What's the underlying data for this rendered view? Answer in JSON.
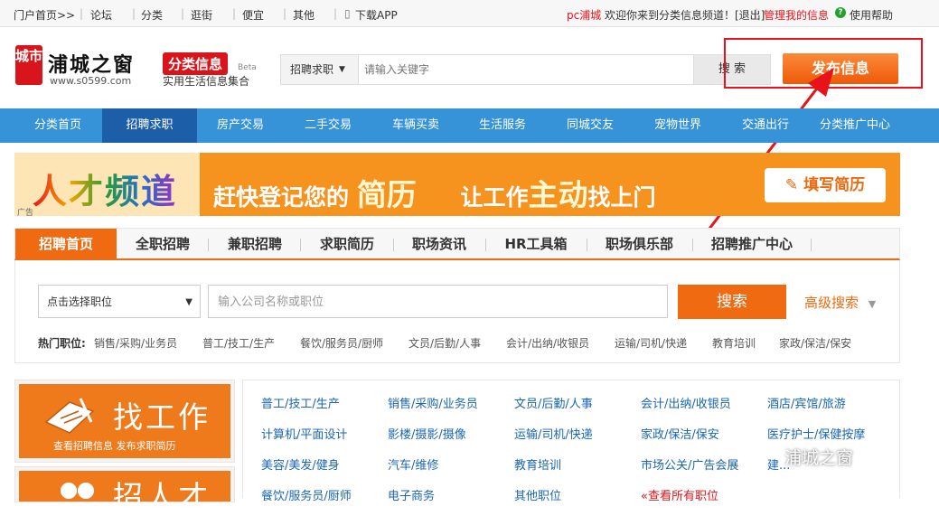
{
  "topbar": {
    "portal": "门户首页>>",
    "links": [
      "论坛",
      "分类",
      "逛街",
      "便宜",
      "其他"
    ],
    "download": "下载APP",
    "user": "pc浦城",
    "welcome": "欢迎你来到分类信息频道！[退出]",
    "manage": "管理我的信息",
    "help": "使用帮助"
  },
  "header": {
    "logo_mark": "城市",
    "logo_name": "浦城之窗",
    "logo_url": "www.s0599.com",
    "category_badge": "分类信息",
    "beta": "Beta",
    "category_sub": "实用生活信息集合",
    "search_category": "招聘求职",
    "search_placeholder": "请输入关键字",
    "search_button": "搜 索",
    "publish_button": "发布信息"
  },
  "nav": {
    "items": [
      "分类首页",
      "招聘求职",
      "房产交易",
      "二手交易",
      "车辆买卖",
      "生活服务",
      "同城交友",
      "宠物世界",
      "交通出行",
      "分类推广中心"
    ],
    "active_index": 1
  },
  "banner": {
    "title": "人才频道",
    "ad_label": "广告",
    "slogan_1": "赶快登记您的",
    "slogan_highlight_1": "简历",
    "slogan_2": "让工作",
    "slogan_highlight_2": "主动",
    "slogan_3": "找上门",
    "button": "填写简历"
  },
  "tabs": {
    "items": [
      "招聘首页",
      "全职招聘",
      "兼职招聘",
      "求职简历",
      "职场资讯",
      "HR工具箱",
      "职场俱乐部",
      "招聘推广中心"
    ],
    "active_index": 0
  },
  "job_search": {
    "select_placeholder": "点击选择职位",
    "input_placeholder": "输入公司名称或职位",
    "button": "搜索",
    "advanced": "高级搜索",
    "hot_label": "热门职位:",
    "hot_items": [
      "销售/采购/业务员",
      "普工/技工/生产",
      "餐饮/服务员/厨师",
      "文员/后勤/人事",
      "会计/出纳/收银员",
      "运输/司机/快递",
      "教育培训",
      "家政/保洁/保安"
    ]
  },
  "side": {
    "find_job_title": "找工作",
    "find_job_sub": "查看招聘信息  发布求职简历",
    "hire_title": "招人才"
  },
  "categories": [
    [
      "普工/技工/生产",
      "销售/采购/业务员",
      "文员/后勤/人事",
      "会计/出纳/收银员",
      "酒店/宾馆/旅游"
    ],
    [
      "计算机/平面设计",
      "影楼/摄影/摄像",
      "运输/司机/快递",
      "家政/保洁/保安",
      "医疗护士/保健按摩"
    ],
    [
      "美容/美发/健身",
      "汽车/维修",
      "教育培训",
      "市场公关/广告会展",
      "建..."
    ],
    [
      "餐饮/服务员/厨师",
      "电子商务",
      "其他职位",
      "«查看所有职位",
      ""
    ]
  ],
  "watermark": "浦城之窗",
  "colors": {
    "accent": "#ef6a10",
    "nav": "#3693d7",
    "link": "#1a66b3",
    "brand_red": "#d9141a"
  }
}
